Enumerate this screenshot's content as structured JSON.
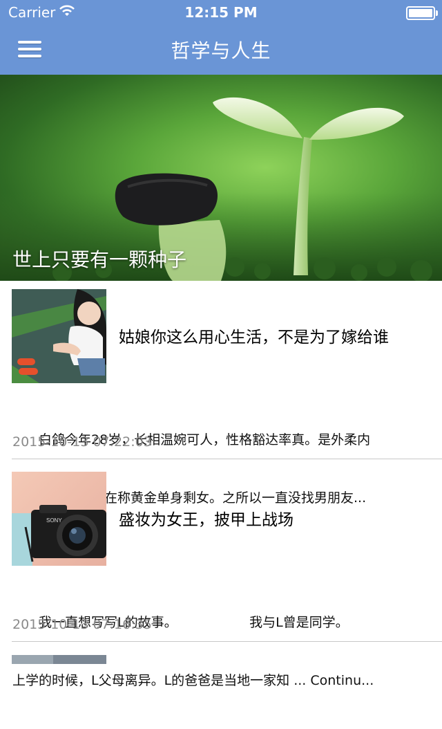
{
  "status_bar": {
    "carrier": "Carrier",
    "time": "12:15 PM"
  },
  "nav": {
    "title": "哲学与人生",
    "menu_icon": "hamburger-menu-icon"
  },
  "banner": {
    "caption": "世上只要有一颗种子"
  },
  "articles": [
    {
      "title": "姑娘你这么用心生活，不是为了嫁给谁",
      "excerpt_line1": "　　白鸽今年28岁，长相温婉可人，性格豁达率真。是外柔内",
      "excerpt_line2": "刚的女汉子，现在称黄金单身剩女。之所以一直没找男朋友...",
      "date": "2015-10-13 07:22:03"
    },
    {
      "title": "盛妆为女王，披甲上战场",
      "excerpt_line1": "　　我一直想写写L的故事。　　　　　　我与L曾是同学。",
      "excerpt_line2": "上学的时候，L父母离异。L的爸爸是当地一家知 ... Continu...",
      "date": "2015-10-13 07:16:35"
    }
  ]
}
